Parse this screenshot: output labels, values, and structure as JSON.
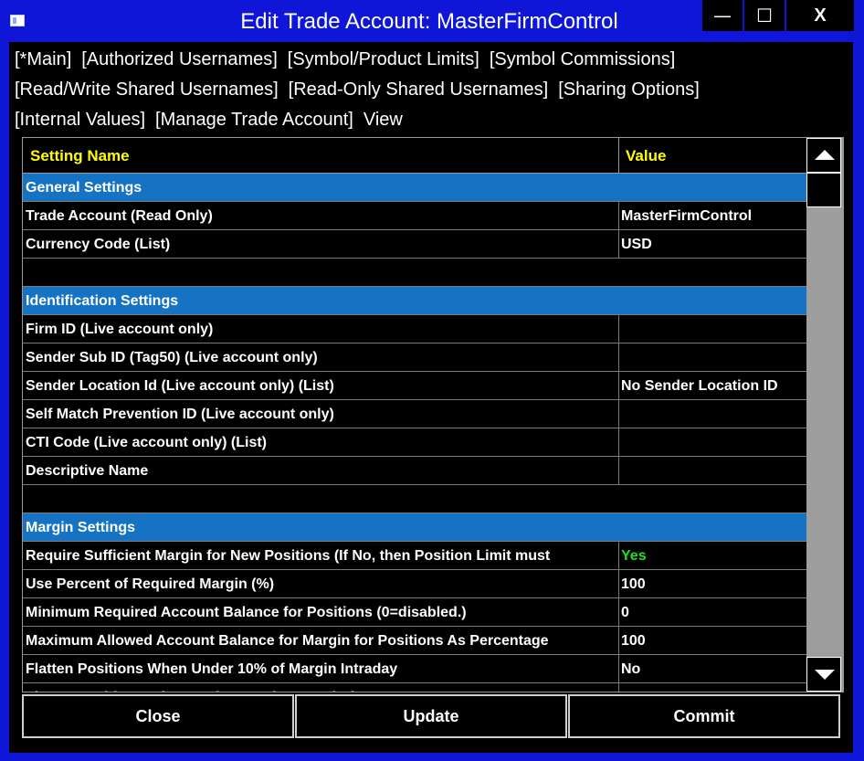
{
  "window": {
    "title": "Edit Trade Account: MasterFirmControl",
    "minimize_glyph": "—",
    "maximize_glyph": "☐",
    "close_glyph": "X"
  },
  "menu": {
    "row1": [
      "[*Main]",
      "[Authorized Usernames]",
      "[Symbol/Product Limits]",
      "[Symbol Commissions]"
    ],
    "row2": [
      "[Read/Write Shared Usernames]",
      "[Read-Only Shared Usernames]",
      "[Sharing Options]"
    ],
    "row3": [
      "[Internal Values]",
      "[Manage Trade Account]",
      "View"
    ]
  },
  "table": {
    "header": {
      "name": "Setting Name",
      "value": "Value"
    },
    "rows": [
      {
        "type": "section",
        "name": "General Settings",
        "value": ""
      },
      {
        "type": "data",
        "name": "Trade Account (Read Only)",
        "value": "MasterFirmControl"
      },
      {
        "type": "data",
        "name": "Currency Code (List)",
        "value": "USD"
      },
      {
        "type": "blank",
        "name": "",
        "value": ""
      },
      {
        "type": "section",
        "name": "Identification Settings",
        "value": ""
      },
      {
        "type": "data",
        "name": "Firm ID (Live account only)",
        "value": ""
      },
      {
        "type": "data",
        "name": "Sender Sub ID (Tag50) (Live account only)",
        "value": ""
      },
      {
        "type": "data",
        "name": "Sender Location Id (Live account only) (List)",
        "value": "No Sender Location ID"
      },
      {
        "type": "data",
        "name": "Self Match Prevention ID (Live account only)",
        "value": ""
      },
      {
        "type": "data",
        "name": "CTI Code (Live account only) (List)",
        "value": ""
      },
      {
        "type": "data",
        "name": "Descriptive Name",
        "value": ""
      },
      {
        "type": "blank",
        "name": "",
        "value": ""
      },
      {
        "type": "section",
        "name": "Margin Settings",
        "value": ""
      },
      {
        "type": "data",
        "name": "Require Sufficient Margin for New Positions (If No, then Position Limit must",
        "value": "Yes",
        "value_color": "#22e022"
      },
      {
        "type": "data",
        "name": "Use Percent of Required Margin (%)",
        "value": "100"
      },
      {
        "type": "data",
        "name": "Minimum Required Account Balance for Positions (0=disabled.)",
        "value": "0"
      },
      {
        "type": "data",
        "name": "Maximum Allowed Account Balance for Margin for Positions As Percentage",
        "value": "100"
      },
      {
        "type": "data",
        "name": "Flatten Positions When Under 10% of Margin Intraday",
        "value": "No"
      },
      {
        "type": "data",
        "name": "Flatten Positions When Under Margin At End of Day",
        "value": "No"
      }
    ]
  },
  "buttons": {
    "close": "Close",
    "update": "Update",
    "commit": "Commit"
  }
}
